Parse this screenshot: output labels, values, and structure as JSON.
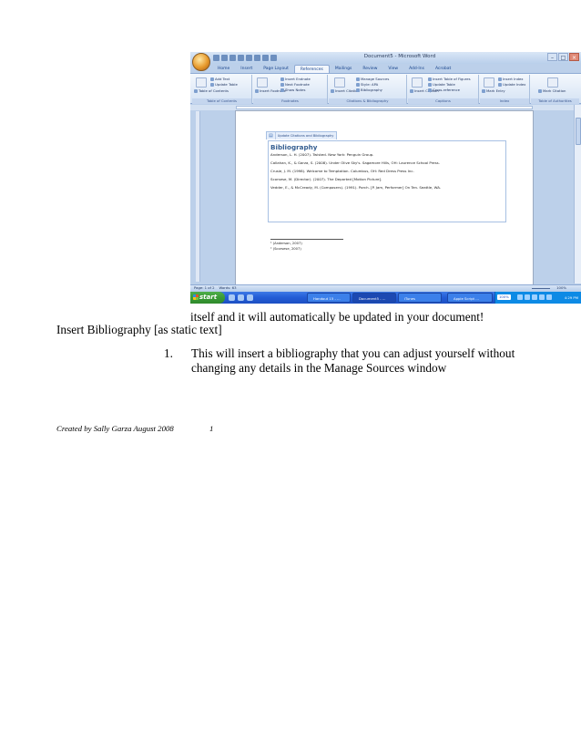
{
  "screenshot": {
    "window_title": "Document5 - Microsoft Word",
    "window_controls": [
      "–",
      "□",
      "×"
    ],
    "tabs": [
      "Home",
      "Insert",
      "Page Layout",
      "References",
      "Mailings",
      "Review",
      "View",
      "Add-Ins",
      "Acrobat"
    ],
    "active_tab": "References",
    "ribbon_groups": [
      {
        "label": "Table of Contents",
        "commands": [
          "Table of Contents",
          "Add Text",
          "Update Table"
        ]
      },
      {
        "label": "Footnotes",
        "commands": [
          "Insert Footnote",
          "Insert Endnote",
          "Next Footnote",
          "Show Notes"
        ]
      },
      {
        "label": "Citations & Bibliography",
        "commands": [
          "Insert Citation",
          "Manage Sources",
          "Style: APA",
          "Bibliography"
        ]
      },
      {
        "label": "Captions",
        "commands": [
          "Insert Caption",
          "Insert Table of Figures",
          "Update Table",
          "Cross-reference"
        ]
      },
      {
        "label": "Index",
        "commands": [
          "Mark Entry",
          "Insert Index",
          "Update Index"
        ]
      },
      {
        "label": "Table of Authorities",
        "commands": [
          "Mark Citation"
        ]
      }
    ],
    "content_control": {
      "update_label": "Update Citations and Bibliography"
    },
    "bibliography": {
      "heading": "Bibliography",
      "entries": [
        "Anderson, L. H. (2007). Twisted. New York: Penguin Group.",
        "Callahan, K., & Garza, S. (2008). Under Olive Sky's. Sagamore Hills, OH: Laurence School Press.",
        "Crusie, J. M. (1998). Welcome to Temptation. Columbus, OH: Red Dress Press Inc.",
        "Scorsese, M. (Director). (2007). The Departed [Motion Picture].",
        "Vedder, E., & McCready, M. (Composers). (1991). Porch. [P. Jam, Performer] On Ten. Seattle, WA."
      ]
    },
    "footnotes": [
      "¹ (Anderson, 2007)",
      "² (Scorsese, 2007)"
    ],
    "status_bar": {
      "page": "Page: 1 of 2",
      "words": "Words: 63",
      "zoom": "100%"
    },
    "taskbar": {
      "start_label": "start",
      "buttons": [
        "Handout 15 - ...",
        "Document5 - ...",
        "iTunes",
        "Apple Script ..."
      ],
      "tray_zoom": "100%",
      "clock": "4:29 PM"
    }
  },
  "document": {
    "caption_line": "itself and it will automatically be updated in your document!",
    "heading": "Insert Bibliography [as static text]",
    "step_number": "1.",
    "step_line1": "This will insert a bibliography that you can adjust yourself without",
    "step_line2": "changing any details in the Manage Sources window"
  },
  "footer": {
    "credit": "Created by Sally Garza August 2008",
    "page_number": "1"
  }
}
